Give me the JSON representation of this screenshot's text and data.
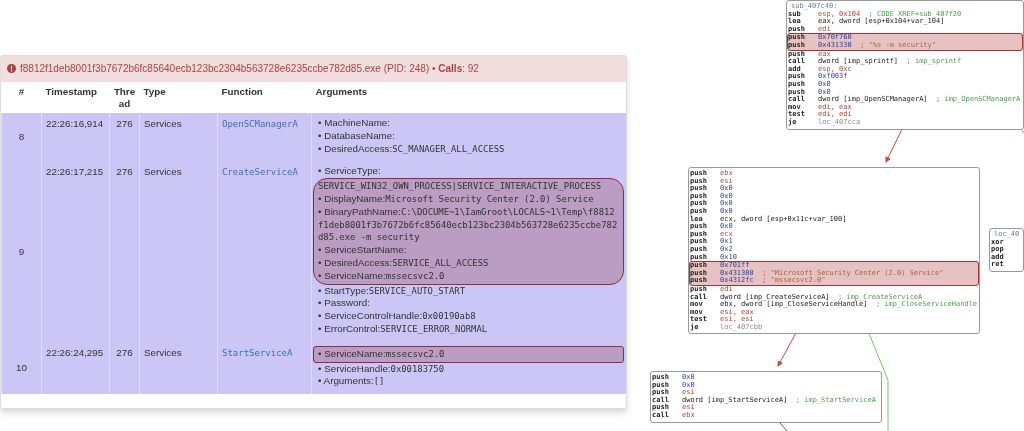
{
  "process_bar": {
    "text": "f8812f1deb8001f3b7672b6fc85640ecb123bc2304b563728e6235ccbe782d85.exe (PID: 248) • **Calls**: 92"
  },
  "table": {
    "columns": [
      "#",
      "Timestamp",
      "Thread",
      "Type",
      "Function",
      "Arguments"
    ],
    "rows": [
      {
        "index": "8",
        "timestamp": "22:26:16,914",
        "thread": "276",
        "type": "Services",
        "function": "OpenSCManagerA",
        "argument_groups": [
          {
            "highlighted": false,
            "arguments": [
              {
                "name": "• MachineName:"
              },
              {
                "name": "• DatabaseName:"
              },
              {
                "name": "• DesiredAccess:",
                "value": "SC_MANAGER_ALL_ACCESS"
              }
            ]
          }
        ]
      },
      {
        "index": "9",
        "timestamp": "22:26:17,215",
        "thread": "276",
        "type": "Services",
        "function": "CreateServiceA",
        "argument_groups": [
          {
            "highlighted": false,
            "arguments": [
              {
                "name": "• ServiceType:"
              }
            ]
          },
          {
            "highlighted": true,
            "arguments": [
              {
                "value": "SERVICE_WIN32_OWN_PROCESS|SERVICE_INTERACTIVE_PROCESS"
              },
              {
                "name": "• DisplayName:",
                "value": "Microsoft Security Center (2.0) Service"
              },
              {
                "name": "• BinaryPathName:",
                "value": "C:\\DOCUME~1\\IamGroot\\LOCALS~1\\Temp\\f8812f1deb8001f3b7672b6fc85640ecb123bc2304b563728e6235ccbe782d85.exe -m security"
              },
              {
                "name": "• ServiceStartName:"
              },
              {
                "name": "• DesiredAccess:",
                "value": "SERVICE_ALL_ACCESS"
              },
              {
                "name": "• ServiceName:",
                "value": "mssecsvc2.0"
              }
            ]
          },
          {
            "highlighted": false,
            "arguments": [
              {
                "name": "• StartType:",
                "value": "SERVICE_AUTO_START"
              },
              {
                "name": "• Password:"
              },
              {
                "name": "• ServiceControlHandle:",
                "value": "0x00190ab8"
              },
              {
                "name": "• ErrorControl:",
                "value": "SERVICE_ERROR_NORMAL"
              }
            ]
          }
        ]
      },
      {
        "index": "10",
        "timestamp": "22:26:24,295",
        "thread": "276",
        "type": "Services",
        "function": "StartServiceA",
        "argument_groups": [
          {
            "highlighted": true,
            "arguments": [
              {
                "name": "• ServiceName:",
                "value": "mssecsvc2.0"
              }
            ]
          },
          {
            "highlighted": false,
            "arguments": [
              {
                "name": "• ServiceHandle:",
                "value": "0x00183750"
              },
              {
                "name": "• Arguments:",
                "value": "[]"
              }
            ]
          }
        ]
      }
    ]
  },
  "graph": {
    "blocks": [
      {
        "label": "sub_407c40:",
        "lines": [
          {
            "mnemonic": "sub",
            "operand": {
              "kind": "reg",
              "text": "esp, 0x104"
            },
            "comment": {
              "kind": "ref",
              "text": "; CODE XREF=sub_407f20"
            },
            "highlighted": false
          },
          {
            "mnemonic": "lea",
            "operand": {
              "kind": "mem",
              "text": "eax, dword [esp+0x104+var_104]"
            },
            "highlighted": false
          },
          {
            "mnemonic": "push",
            "operand": {
              "kind": "reg",
              "text": "edi"
            },
            "highlighted": false
          },
          {
            "mnemonic": "push",
            "operand": {
              "kind": "imm",
              "text": "0x70f760"
            },
            "highlighted": true
          },
          {
            "mnemonic": "push",
            "operand": {
              "kind": "imm",
              "text": "0x431330"
            },
            "comment": {
              "kind": "string",
              "text": "; \"%s -m security\""
            },
            "highlighted": true
          },
          {
            "mnemonic": "push",
            "operand": {
              "kind": "reg",
              "text": "eax"
            },
            "highlighted": false
          },
          {
            "mnemonic": "call",
            "operand": {
              "kind": "mem",
              "text": "dword [imp_sprintf]"
            },
            "comment": {
              "kind": "ref",
              "text": "; imp_sprintf"
            },
            "highlighted": false
          },
          {
            "mnemonic": "add",
            "operand": {
              "kind": "reg",
              "text": "esp, 0xc"
            },
            "highlighted": false
          },
          {
            "mnemonic": "push",
            "operand": {
              "kind": "imm",
              "text": "0xf003f"
            },
            "highlighted": false
          },
          {
            "mnemonic": "push",
            "operand": {
              "kind": "imm",
              "text": "0x0"
            },
            "highlighted": false
          },
          {
            "mnemonic": "push",
            "operand": {
              "kind": "imm",
              "text": "0x0"
            },
            "highlighted": false
          },
          {
            "mnemonic": "call",
            "operand": {
              "kind": "mem",
              "text": "dword [imp_OpenSCManagerA]"
            },
            "comment": {
              "kind": "ref",
              "text": "; imp_OpenSCManagerA"
            },
            "highlighted": false
          },
          {
            "mnemonic": "mov",
            "operand": {
              "kind": "reg",
              "text": "edi, eax"
            },
            "highlighted": false
          },
          {
            "mnemonic": "test",
            "operand": {
              "kind": "reg",
              "text": "edi, edi"
            },
            "highlighted": false
          },
          {
            "mnemonic": "je",
            "operand": {
              "kind": "loc",
              "text": "loc_407cca"
            },
            "highlighted": false
          }
        ]
      },
      {
        "lines": [
          {
            "mnemonic": "push",
            "operand": {
              "kind": "reg",
              "text": "ebx"
            },
            "highlighted": false
          },
          {
            "mnemonic": "push",
            "operand": {
              "kind": "reg",
              "text": "esi"
            },
            "highlighted": false
          },
          {
            "mnemonic": "push",
            "operand": {
              "kind": "imm",
              "text": "0x0"
            },
            "highlighted": false
          },
          {
            "mnemonic": "push",
            "operand": {
              "kind": "imm",
              "text": "0x0"
            },
            "highlighted": false
          },
          {
            "mnemonic": "push",
            "operand": {
              "kind": "imm",
              "text": "0x0"
            },
            "highlighted": false
          },
          {
            "mnemonic": "push",
            "operand": {
              "kind": "imm",
              "text": "0x0"
            },
            "highlighted": false
          },
          {
            "mnemonic": "lea",
            "operand": {
              "kind": "mem",
              "text": "ecx, dword [esp+0x11c+var_100]"
            },
            "highlighted": false
          },
          {
            "mnemonic": "push",
            "operand": {
              "kind": "imm",
              "text": "0x0"
            },
            "highlighted": false
          },
          {
            "mnemonic": "push",
            "operand": {
              "kind": "reg",
              "text": "ecx"
            },
            "highlighted": false
          },
          {
            "mnemonic": "push",
            "operand": {
              "kind": "imm",
              "text": "0x1"
            },
            "highlighted": false
          },
          {
            "mnemonic": "push",
            "operand": {
              "kind": "imm",
              "text": "0x2"
            },
            "highlighted": false
          },
          {
            "mnemonic": "push",
            "operand": {
              "kind": "imm",
              "text": "0x10"
            },
            "highlighted": false
          },
          {
            "mnemonic": "push",
            "operand": {
              "kind": "imm",
              "text": "0x701ff"
            },
            "highlighted": true
          },
          {
            "mnemonic": "push",
            "operand": {
              "kind": "imm",
              "text": "0x431308"
            },
            "comment": {
              "kind": "string",
              "text": "; \"Microsoft Security Center (2.0) Service\""
            },
            "highlighted": true
          },
          {
            "mnemonic": "push",
            "operand": {
              "kind": "imm",
              "text": "0x4312fc"
            },
            "comment": {
              "kind": "string",
              "text": "; \"mssecsvc2.0\""
            },
            "highlighted": true
          },
          {
            "mnemonic": "push",
            "operand": {
              "kind": "reg",
              "text": "edi"
            },
            "highlighted": false
          },
          {
            "mnemonic": "call",
            "operand": {
              "kind": "mem",
              "text": "dword [imp_CreateServiceA]"
            },
            "comment": {
              "kind": "ref",
              "text": "; imp_CreateServiceA"
            },
            "highlighted": false
          },
          {
            "mnemonic": "mov",
            "operand": {
              "kind": "mem",
              "text": "ebx, dword [imp_CloseServiceHandle]"
            },
            "comment": {
              "kind": "ref",
              "text": "; imp_CloseServiceHandle"
            },
            "highlighted": false
          },
          {
            "mnemonic": "mov",
            "operand": {
              "kind": "reg",
              "text": "esi, eax"
            },
            "highlighted": false
          },
          {
            "mnemonic": "test",
            "operand": {
              "kind": "reg",
              "text": "esi, esi"
            },
            "highlighted": false
          },
          {
            "mnemonic": "je",
            "operand": {
              "kind": "loc",
              "text": "loc_407cbb"
            },
            "highlighted": false
          }
        ]
      },
      {
        "lines": [
          {
            "mnemonic": "push",
            "operand": {
              "kind": "imm",
              "text": "0x0"
            },
            "highlighted": false
          },
          {
            "mnemonic": "push",
            "operand": {
              "kind": "imm",
              "text": "0x0"
            },
            "highlighted": false
          },
          {
            "mnemonic": "push",
            "operand": {
              "kind": "reg",
              "text": "esi"
            },
            "highlighted": false
          },
          {
            "mnemonic": "call",
            "operand": {
              "kind": "mem",
              "text": "dword [imp_StartServiceA]"
            },
            "comment": {
              "kind": "ref",
              "text": "; imp_StartServiceA"
            },
            "highlighted": false
          },
          {
            "mnemonic": "push",
            "operand": {
              "kind": "reg",
              "text": "esi"
            },
            "highlighted": false
          },
          {
            "mnemonic": "call",
            "operand": {
              "kind": "reg",
              "text": "ebx"
            },
            "highlighted": false
          }
        ]
      },
      {
        "label": "loc_40",
        "lines": [
          {
            "mnemonic": "xor",
            "highlighted": false
          },
          {
            "mnemonic": "pop",
            "highlighted": false
          },
          {
            "mnemonic": "add",
            "highlighted": false
          },
          {
            "mnemonic": "ret",
            "highlighted": false
          }
        ]
      }
    ]
  }
}
